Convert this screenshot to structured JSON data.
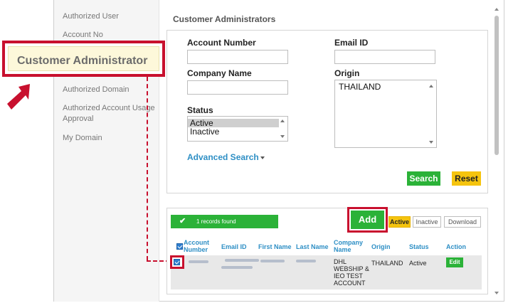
{
  "sidebar": {
    "items": [
      {
        "label": "Authorized User"
      },
      {
        "label": "Account No"
      },
      {
        "label": "Authorized Domain"
      },
      {
        "label": "Authorized Account Usage Approval"
      },
      {
        "label": "My Domain"
      }
    ],
    "highlighted_label": "Customer Administrator"
  },
  "content": {
    "title": "Customer Administrators"
  },
  "search": {
    "account_number_label": "Account Number",
    "account_number_value": "",
    "email_id_label": "Email ID",
    "email_id_value": "",
    "company_name_label": "Company Name",
    "company_name_value": "",
    "origin_label": "Origin",
    "origin_options": [
      "THAILAND"
    ],
    "status_label": "Status",
    "status_options": [
      "Active",
      "Inactive"
    ],
    "status_selected": "Active",
    "advanced_search_label": "Advanced Search",
    "search_button": "Search",
    "reset_button": "Reset"
  },
  "results": {
    "records_found": "1 records found",
    "add_button": "Add",
    "filter_active": "Active",
    "filter_inactive": "Inactive",
    "download_button": "Download",
    "columns": {
      "account_number": "Account Number",
      "email_id": "Email ID",
      "first_name": "First Name",
      "last_name": "Last Name",
      "company_name": "Company Name",
      "origin": "Origin",
      "status": "Status",
      "action": "Action"
    },
    "rows": [
      {
        "company_name": "DHL WEBSHIP & IEO TEST ACCOUNT",
        "origin": "THAILAND",
        "status": "Active",
        "action": "Edit"
      }
    ]
  },
  "colors": {
    "accent_red": "#c8102e",
    "green": "#2bb238",
    "yellow": "#f5c40e",
    "link_blue": "#2e8fc5"
  }
}
